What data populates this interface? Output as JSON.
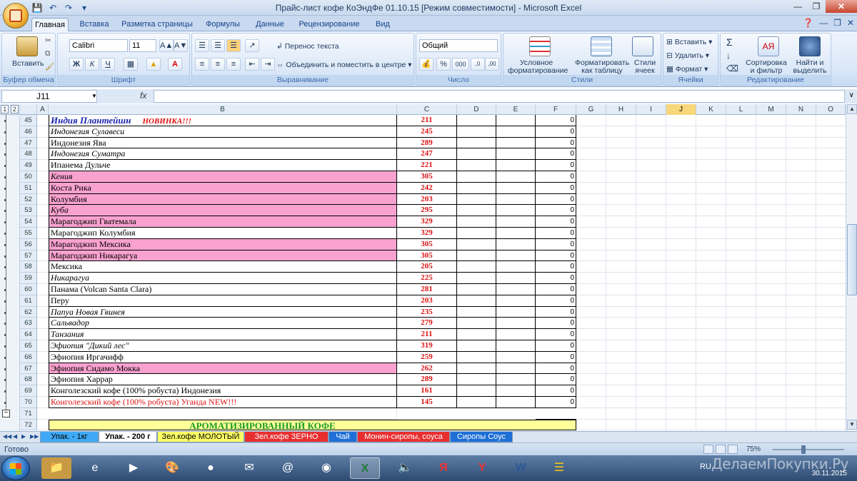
{
  "window": {
    "title": "Прайс-лист кофе КоЭндФе 01.10.15  [Режим совместимости] - Microsoft Excel"
  },
  "ribbon_tabs": [
    "Главная",
    "Вставка",
    "Разметка страницы",
    "Формулы",
    "Данные",
    "Рецензирование",
    "Вид"
  ],
  "ribbon": {
    "clipboard": {
      "label": "Буфер обмена",
      "paste": "Вставить"
    },
    "font": {
      "label": "Шрифт",
      "name": "Calibri",
      "size": "11",
      "bold": "Ж",
      "italic": "К",
      "underline": "Ч"
    },
    "alignment": {
      "label": "Выравнивание",
      "wrap": "Перенос текста",
      "merge": "Объединить и поместить в центре"
    },
    "number": {
      "label": "Число",
      "format": "Общий",
      "percent": "%",
      "thousands": "000"
    },
    "styles": {
      "label": "Стили",
      "conditional": "Условное форматирование",
      "table": "Форматировать как таблицу",
      "cell": "Стили ячеек"
    },
    "cells": {
      "label": "Ячейки",
      "insert": "Вставить",
      "delete": "Удалить",
      "format": "Формат"
    },
    "editing": {
      "label": "Редактирование",
      "sort": "Сортировка и фильтр",
      "find": "Найти и выделить"
    }
  },
  "formula_bar": {
    "name_box": "J11",
    "fx": "fx",
    "value": ""
  },
  "outline_levels": [
    "1",
    "2"
  ],
  "columns": [
    "A",
    "B",
    "C",
    "D",
    "E",
    "F",
    "G",
    "H",
    "I",
    "J",
    "K",
    "L",
    "M",
    "N",
    "O"
  ],
  "rows": [
    {
      "num": "45",
      "name": "Индия Плантейшн",
      "badge": "НОВИНКА!!!",
      "price": "211",
      "f": "0",
      "style": "bluebold"
    },
    {
      "num": "46",
      "name": "Индонезия Сулавеси",
      "price": "245",
      "f": "0",
      "style": "italic"
    },
    {
      "num": "47",
      "name": "Индонезия Ява",
      "price": "289",
      "f": "0"
    },
    {
      "num": "48",
      "name": "Индонезия Суматра",
      "price": "247",
      "f": "0",
      "style": "italic"
    },
    {
      "num": "49",
      "name": "Ипанема Дульче",
      "price": "221",
      "f": "0"
    },
    {
      "num": "50",
      "name": "Кения",
      "price": "305",
      "f": "0",
      "style": "pink italic"
    },
    {
      "num": "51",
      "name": "Коста Рика",
      "price": "242",
      "f": "0",
      "style": "pink"
    },
    {
      "num": "52",
      "name": "Колумбия",
      "price": "203",
      "f": "0",
      "style": "pink"
    },
    {
      "num": "53",
      "name": "Куба",
      "price": "295",
      "f": "0",
      "style": "pink italic"
    },
    {
      "num": "54",
      "name": "Марагоджип Гватемала",
      "price": "329",
      "f": "0",
      "style": "pink"
    },
    {
      "num": "55",
      "name": "Марагоджип Колумбия",
      "price": "329",
      "f": "0"
    },
    {
      "num": "56",
      "name": "Марагоджип Мексика",
      "price": "305",
      "f": "0",
      "style": "pink"
    },
    {
      "num": "57",
      "name": "Марагоджип Никарагуа",
      "price": "305",
      "f": "0",
      "style": "pink"
    },
    {
      "num": "58",
      "name": "Мексика",
      "price": "205",
      "f": "0"
    },
    {
      "num": "59",
      "name": "Никарагуа",
      "price": "225",
      "f": "0",
      "style": "italic"
    },
    {
      "num": "60",
      "name": "Панама (Volcan Santa Clara)",
      "price": "281",
      "f": "0"
    },
    {
      "num": "61",
      "name": "Перу",
      "price": "203",
      "f": "0"
    },
    {
      "num": "62",
      "name": "Папуа Новая Гвинея",
      "price": "235",
      "f": "0",
      "style": "italic"
    },
    {
      "num": "63",
      "name": "Сальвадор",
      "price": "279",
      "f": "0",
      "style": "italic"
    },
    {
      "num": "64",
      "name": "Танзания",
      "price": "211",
      "f": "0",
      "style": "italic"
    },
    {
      "num": "65",
      "name": "Эфиопия \"Дикий лес\"",
      "price": "319",
      "f": "0",
      "style": "italic"
    },
    {
      "num": "66",
      "name": "Эфиопия Иргачифф",
      "price": "259",
      "f": "0"
    },
    {
      "num": "67",
      "name": "Эфиопия Сидамо Мокка",
      "price": "262",
      "f": "0",
      "style": "pink"
    },
    {
      "num": "68",
      "name": "Эфиопия Харрар",
      "price": "289",
      "f": "0"
    },
    {
      "num": "69",
      "name": "Конголезский кофе (100% робуста) Индонезия",
      "price": "161",
      "f": "0"
    },
    {
      "num": "70",
      "name": "Конголезский кофе (100% робуста) Уганда NEW!!!",
      "price": "145",
      "f": "0",
      "style": "redtext"
    },
    {
      "num": "71",
      "name": "",
      "price": "",
      "f": "",
      "style": "empty"
    },
    {
      "num": "72",
      "name": "АРОМАТИЗИРОВАННЫЙ КОФЕ",
      "price": "",
      "f": "",
      "style": "header"
    }
  ],
  "sheet_tabs": [
    {
      "label": "Упак. - 1кг",
      "color": "#3fa9f5"
    },
    {
      "label": "Упак. - 200 г",
      "color": "#ffffff"
    },
    {
      "label": "Зел.кофе МОЛОТЫЙ",
      "color": "#ffff66"
    },
    {
      "label": "Зел.кофе ЗЕРНО",
      "color": "#e82f2f"
    },
    {
      "label": "Чай",
      "color": "#1f6fd6"
    },
    {
      "label": "Монин-сиропы, соуса",
      "color": "#e82f2f"
    },
    {
      "label": "Сиропы Соус",
      "color": "#1f6fd6"
    }
  ],
  "status": {
    "text": "Готово",
    "zoom": "75%"
  },
  "taskbar": {
    "lang": "RU",
    "date": "30.11.2015",
    "watermark": "ДелаемПокупки.Ру"
  },
  "colors": {
    "pink": "#f9a2cf",
    "header_yellow": "#ffff99",
    "price_red": "#d11111",
    "title_blue": "#1a25b0"
  }
}
